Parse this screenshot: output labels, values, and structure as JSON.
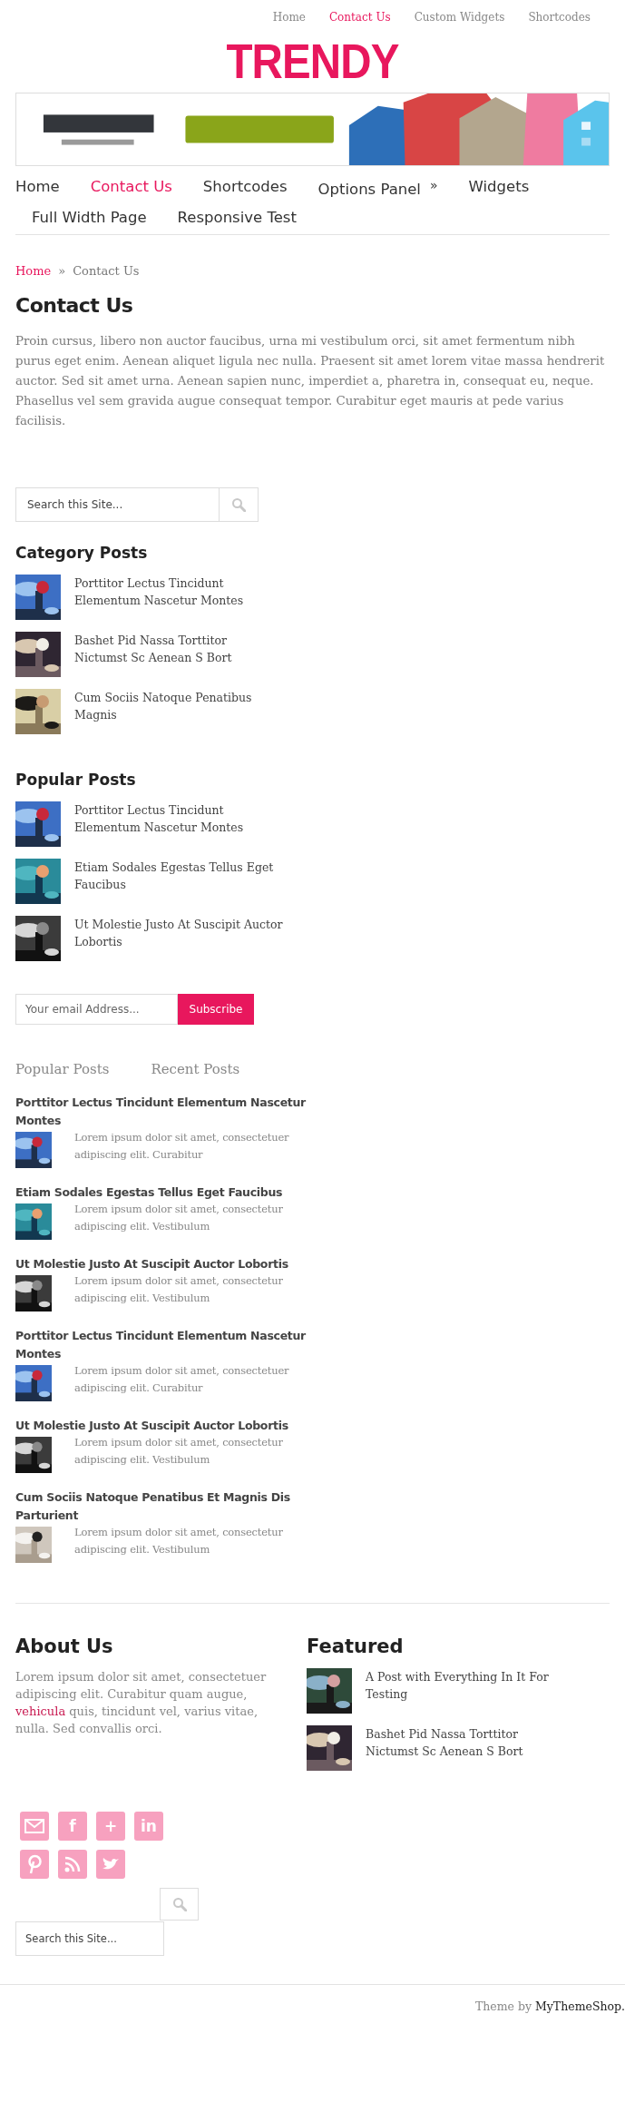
{
  "top_nav": [
    {
      "label": "Home",
      "selected": false
    },
    {
      "label": "Contact Us",
      "selected": true
    },
    {
      "label": "Custom Widgets",
      "selected": false
    },
    {
      "label": "Shortcodes",
      "selected": false
    }
  ],
  "logo": "TRENDY",
  "main_nav": [
    {
      "label": "Home",
      "selected": false,
      "has_submenu": false
    },
    {
      "label": "Contact Us",
      "selected": true,
      "has_submenu": false
    },
    {
      "label": "Shortcodes",
      "selected": false,
      "has_submenu": false
    },
    {
      "label": "Options Panel",
      "selected": false,
      "has_submenu": true,
      "submenu_mark": "»"
    },
    {
      "label": "Widgets",
      "selected": false,
      "has_submenu": false
    },
    {
      "label": "Full Width Page",
      "selected": false,
      "has_submenu": false
    },
    {
      "label": "Responsive Test",
      "selected": false,
      "has_submenu": false
    }
  ],
  "breadcrumb": {
    "home": "Home",
    "separator": "»",
    "current": "Contact Us"
  },
  "page": {
    "title": "Contact Us",
    "body": "Proin cursus, libero non auctor faucibus, urna mi vestibulum orci, sit amet fermentum nibh purus eget enim. Aenean aliquet ligula nec nulla. Praesent sit amet lorem vitae massa hendrerit auctor. Sed sit amet urna. Aenean sapien nunc, imperdiet a, pharetra in, consequat eu, neque. Phasellus vel sem gravida augue consequat tempor. Curabitur eget mauris at pede varius facilisis."
  },
  "sidebar": {
    "search": {
      "placeholder": "Search this Site..."
    },
    "category_posts": {
      "title": "Category Posts",
      "items": [
        {
          "title": "Porttitor Lectus Tincidunt Elementum Nascetur Montes"
        },
        {
          "title": "Bashet Pid Nassa Torttitor Nictumst Sc Aenean S Bort"
        },
        {
          "title": "Cum Sociis Natoque Penatibus Magnis"
        }
      ]
    },
    "popular_posts": {
      "title": "Popular Posts",
      "items": [
        {
          "title": "Porttitor Lectus Tincidunt Elementum Nascetur Montes"
        },
        {
          "title": "Etiam Sodales Egestas Tellus Eget Faucibus"
        },
        {
          "title": "Ut Molestie Justo At Suscipit Auctor Lobortis"
        }
      ]
    },
    "subscribe": {
      "placeholder": "Your email Address...",
      "button": "Subscribe"
    },
    "tabs": [
      {
        "label": "Popular Posts"
      },
      {
        "label": "Recent Posts"
      }
    ],
    "tab_posts": [
      {
        "title": "Porttitor Lectus Tincidunt Elementum Nascetur Montes",
        "excerpt": "Lorem ipsum dolor sit amet, consectetuer adipiscing elit. Curabitur"
      },
      {
        "title": "Etiam Sodales Egestas Tellus Eget Faucibus",
        "excerpt": "Lorem ipsum dolor sit amet, consectetur adipiscing elit. Vestibulum"
      },
      {
        "title": "Ut Molestie Justo At Suscipit Auctor Lobortis",
        "excerpt": "Lorem ipsum dolor sit amet, consectetur adipiscing elit. Vestibulum"
      },
      {
        "title": "Porttitor Lectus Tincidunt Elementum Nascetur Montes",
        "excerpt": "Lorem ipsum dolor sit amet, consectetuer adipiscing elit. Curabitur"
      },
      {
        "title": "Ut Molestie Justo At Suscipit Auctor Lobortis",
        "excerpt": "Lorem ipsum dolor sit amet, consectetur adipiscing elit. Vestibulum"
      },
      {
        "title": "Cum Sociis Natoque Penatibus Et Magnis Dis Parturient",
        "excerpt": "Lorem ipsum dolor sit amet, consectetur adipiscing elit. Vestibulum"
      }
    ]
  },
  "footer": {
    "about": {
      "title": "About Us",
      "text_before": "Lorem ipsum dolor sit amet, consectetuer adipiscing elit. Curabitur quam augue,",
      "link": "vehicula",
      "text_after": "quis, tincidunt vel, varius vitae, nulla. Sed convallis orci."
    },
    "featured": {
      "title": "Featured",
      "items": [
        {
          "title": "A Post with Everything In It For Testing"
        },
        {
          "title": "Bashet Pid Nassa Torttitor Nictumst Sc Aenean S Bort"
        }
      ]
    },
    "social": [
      {
        "kind": "mail"
      },
      {
        "kind": "glyph",
        "glyph": "f"
      },
      {
        "kind": "glyph",
        "glyph": "+"
      },
      {
        "kind": "glyph",
        "glyph": "in"
      },
      {
        "kind": "pinterest"
      },
      {
        "kind": "rss"
      },
      {
        "kind": "bird"
      }
    ],
    "search": {
      "placeholder": "Search this Site..."
    },
    "credit": {
      "prefix": "Theme by",
      "link": "MyThemeShop."
    }
  }
}
